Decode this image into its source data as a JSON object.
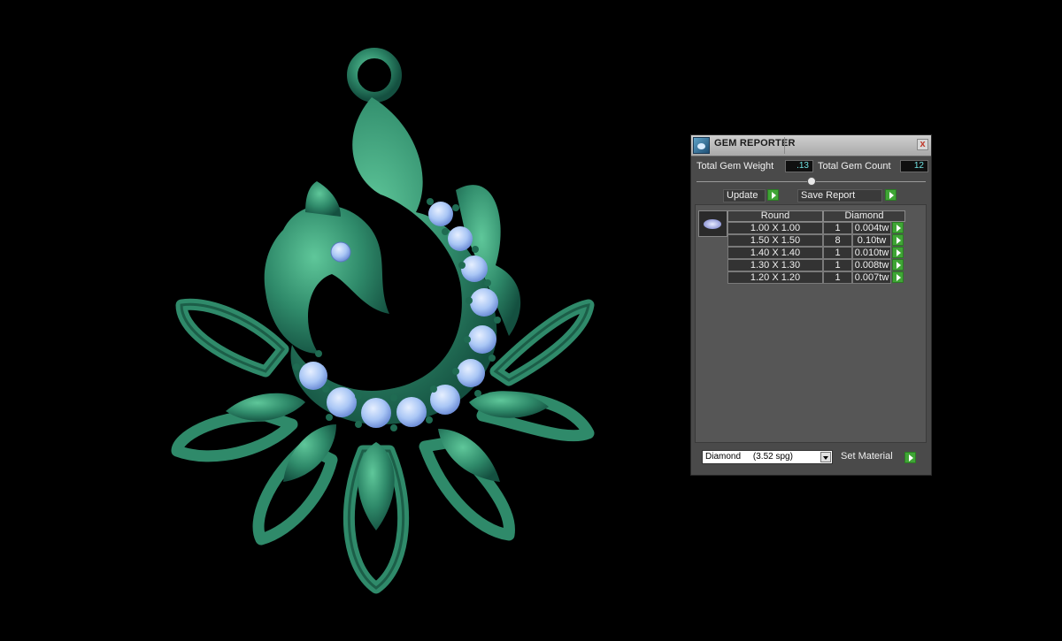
{
  "panel": {
    "title": "GEM REPORTER",
    "close_glyph": "x",
    "total_weight_label": "Total Gem Weight",
    "total_weight_value": ".13",
    "total_count_label": "Total Gem Count",
    "total_count_value": "12",
    "update_label": "Update",
    "save_report_label": "Save Report",
    "set_material_label": "Set Material",
    "material_selected": "Diamond     (3.52 spg)"
  },
  "table": {
    "headers": [
      "Round",
      "Diamond"
    ],
    "rows": [
      {
        "size": "1.00 X 1.00",
        "count": "1",
        "weight": "0.004tw"
      },
      {
        "size": "1.50 X 1.50",
        "count": "8",
        "weight": "0.10tw"
      },
      {
        "size": "1.40 X 1.40",
        "count": "1",
        "weight": "0.010tw"
      },
      {
        "size": "1.30 X 1.30",
        "count": "1",
        "weight": "0.008tw"
      },
      {
        "size": "1.20 X 1.20",
        "count": "1",
        "weight": "0.007tw"
      }
    ]
  },
  "icons": {
    "app": "gem-reporter-app-icon",
    "close": "close-icon",
    "play": "green-play-arrow-icon",
    "gem": "round-gem-thumbnail-icon",
    "dropdown": "chevron-down-icon"
  },
  "colors": {
    "metal": "#2f8a6a",
    "gem": "#a9c6f5",
    "panel_bg": "#4a4a4a",
    "value_text": "#6fe0e0",
    "play_button": "#3fa535"
  }
}
